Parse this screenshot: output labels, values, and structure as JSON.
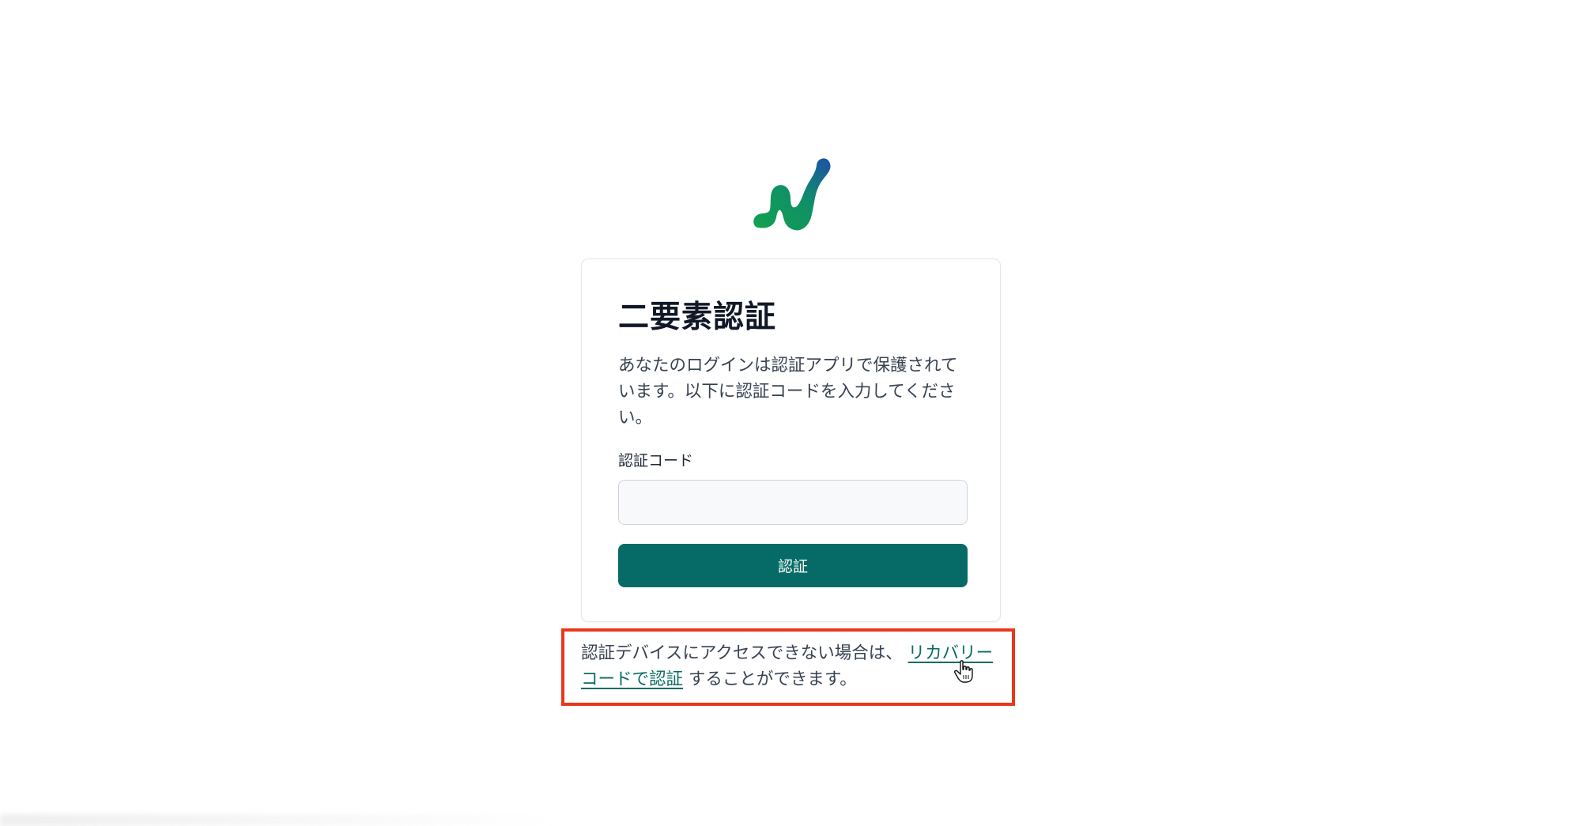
{
  "logo": {
    "icon": "company-logo-icon",
    "colors": {
      "green": "#10a352",
      "blue": "#1e4fa8"
    }
  },
  "card": {
    "title": "二要素認証",
    "description": "あなたのログインは認証アプリで保護されています。以下に認証コードを入力してください。",
    "code_label": "認証コード",
    "code_value": "",
    "code_placeholder": "",
    "submit_label": "認証"
  },
  "recovery": {
    "prefix": "認証デバイスにアクセスできない場合は、",
    "link_label": "リカバリーコードで認証",
    "suffix": "することができます。"
  },
  "colors": {
    "primary": "#066b66",
    "link": "#0a6b62",
    "highlight": "#e8381c"
  },
  "cursor": {
    "icon": "hand-pointer-icon"
  }
}
